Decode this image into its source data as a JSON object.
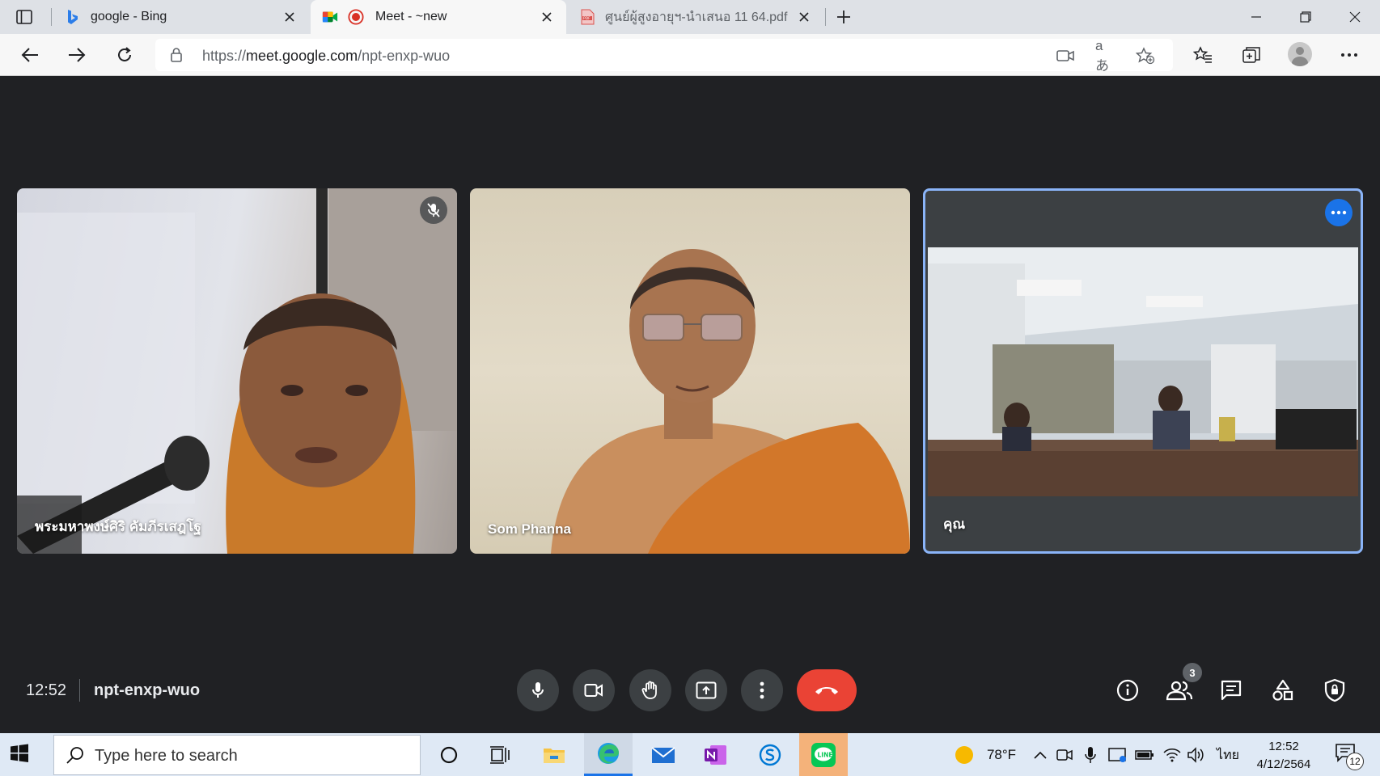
{
  "browser": {
    "tabs": [
      {
        "title": "google - Bing",
        "favicon": "bing-icon"
      },
      {
        "title": "Meet - ~new",
        "favicon": "google-meet-icon",
        "active": true
      },
      {
        "title": "ศูนย์ผู้สูงอายุฯ-นำเสนอ 11 64.pdf",
        "favicon": "pdf-icon"
      }
    ],
    "address": {
      "scheme": "https://",
      "host": "meet.google.com",
      "path": "/npt-enxp-wuo"
    },
    "read_aloud_label": "aあ"
  },
  "meet": {
    "participants": [
      {
        "name": "พระมหาพงษ์ศิริ คัมภีรเสฎโฐ",
        "muted": true
      },
      {
        "name": "Som Phanna",
        "muted": false
      },
      {
        "name": "คุณ",
        "self": true
      }
    ],
    "time": "12:52",
    "meeting_code": "npt-enxp-wuo",
    "participant_count": "3",
    "colors": {
      "end_call": "#ea4335",
      "accent": "#1a73e8",
      "self_border": "#8ab4f8",
      "background": "#202124"
    }
  },
  "taskbar": {
    "search_placeholder": "Type here to search",
    "weather": "78°F",
    "language": "ไทย",
    "clock_time": "12:52",
    "clock_date": "4/12/2564",
    "notification_count": "12"
  }
}
